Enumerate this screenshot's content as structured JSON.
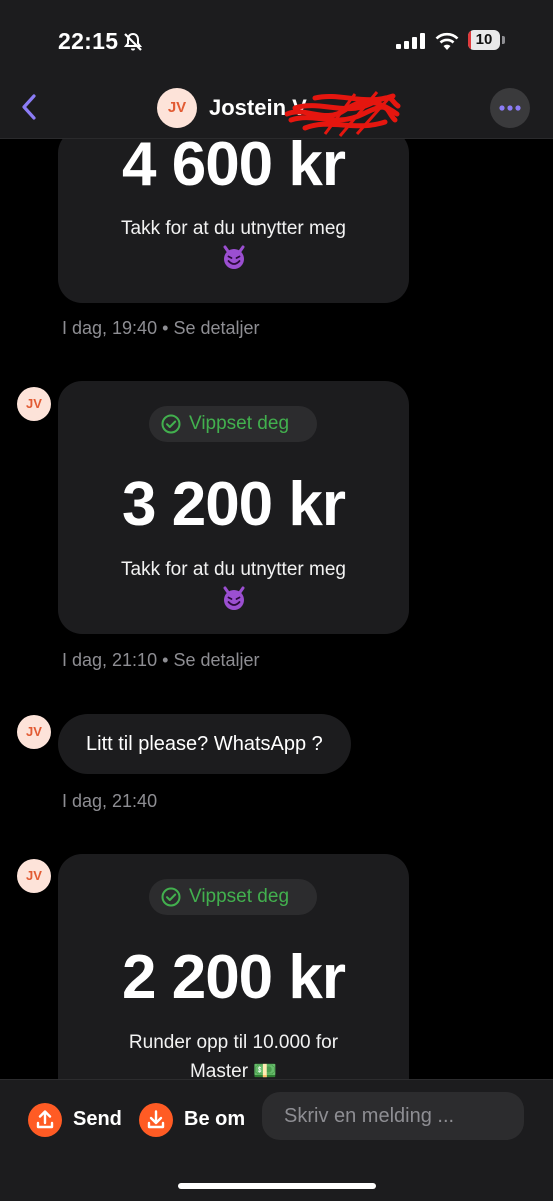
{
  "status_bar": {
    "time": "22:15",
    "battery": "10",
    "battery_level": 0.1
  },
  "header": {
    "avatar_initials": "JV",
    "name": "Jostein V"
  },
  "messages": [
    {
      "amount": "4 600 kr",
      "note": "Takk for at du utnytter meg",
      "emoji": "😈",
      "time": "I dag, 19:40",
      "details": "Se detaljer"
    },
    {
      "avatar": "JV",
      "badge": "Vippset deg",
      "amount": "3 200 kr",
      "note": "Takk for at du utnytter meg",
      "emoji": "😈",
      "time": "I dag, 21:10",
      "details": "Se detaljer"
    },
    {
      "avatar": "JV",
      "text": "Litt til please? WhatsApp ?",
      "time": "I dag, 21:40"
    },
    {
      "avatar": "JV",
      "badge": "Vippset deg",
      "amount": "2 200 kr",
      "note_line1": "Runder opp til 10.000 for",
      "note_line2": "Master 💵"
    }
  ],
  "separator": "•",
  "bottom_bar": {
    "send_label": "Send",
    "request_label": "Be om",
    "input_placeholder": "Skriv en melding ..."
  },
  "colors": {
    "accent_orange": "#ff5b24",
    "accent_purple": "#8b7cf6",
    "success_green": "#42b04e",
    "card_bg": "#1c1c1e"
  }
}
